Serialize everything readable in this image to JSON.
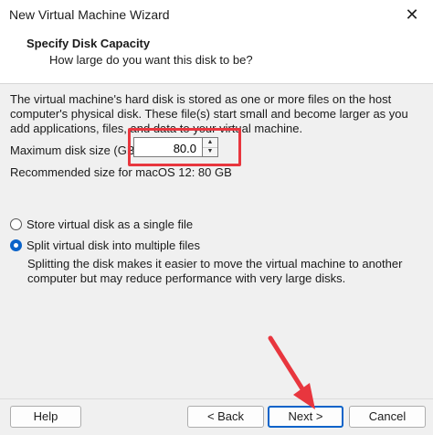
{
  "window": {
    "title": "New Virtual Machine Wizard",
    "close_glyph": "✕"
  },
  "header": {
    "title": "Specify Disk Capacity",
    "subtitle": "How large do you want this disk to be?"
  },
  "body": {
    "description": "The virtual machine's hard disk is stored as one or more files on the host computer's physical disk. These file(s) start small and become larger as you add applications, files, and data to your virtual machine.",
    "max_size_label": "Maximum disk size (GB):",
    "max_size_value": "80.0",
    "recommended": "Recommended size for macOS 12: 80 GB",
    "options": [
      {
        "label": "Store virtual disk as a single file",
        "checked": false
      },
      {
        "label": "Split virtual disk into multiple files",
        "checked": true
      }
    ],
    "split_description": "Splitting the disk makes it easier to move the virtual machine to another computer but may reduce performance with very large disks."
  },
  "footer": {
    "help": "Help",
    "back": "< Back",
    "next": "Next >",
    "cancel": "Cancel"
  },
  "colors": {
    "annotation_red": "#e8363e",
    "accent_blue": "#0a63c9"
  }
}
